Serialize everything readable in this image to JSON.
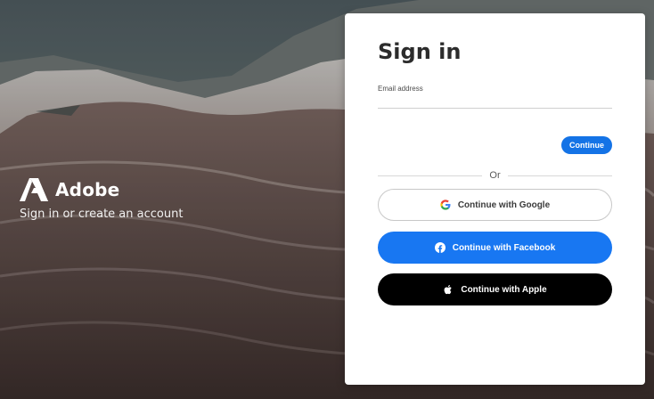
{
  "brand": {
    "name": "Adobe",
    "tagline": "Sign in or create an account",
    "logo_icon": "adobe-logo-icon"
  },
  "signin": {
    "title": "Sign in",
    "email_label": "Email address",
    "email_value": "",
    "continue_label": "Continue",
    "divider_text": "Or",
    "google_label": "Continue with Google",
    "facebook_label": "Continue with Facebook",
    "apple_label": "Continue with Apple"
  },
  "colors": {
    "accent": "#1473e6",
    "facebook": "#1877f2",
    "apple": "#000000",
    "card": "#ffffff"
  },
  "icons": {
    "google": "google-icon",
    "facebook": "facebook-icon",
    "apple": "apple-icon"
  }
}
